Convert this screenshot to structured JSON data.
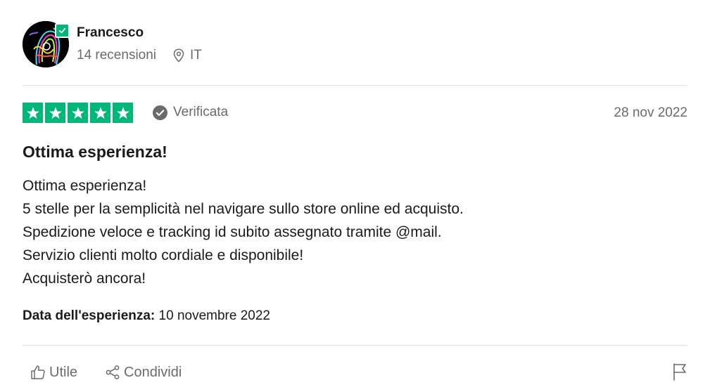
{
  "reviewer": {
    "name": "Francesco",
    "reviews_count": "14 recensioni",
    "country": "IT",
    "avatar_icon": "psychedelic-portrait-avatar"
  },
  "review": {
    "rating": 5,
    "rating_max": 5,
    "verified_label": "Verificata",
    "date": "28 nov 2022",
    "title": "Ottima esperienza!",
    "body_lines": [
      "Ottima esperienza!",
      "5 stelle per la semplicità nel navigare sullo store online ed acquisto.",
      "Spedizione veloce e tracking id subito assegnato tramite @mail.",
      "Servizio clienti molto cordiale e disponibile!",
      "Acquisterò ancora!"
    ],
    "experience_label": "Data dell'esperienza:",
    "experience_date": "10 novembre 2022"
  },
  "actions": {
    "useful_label": "Utile",
    "share_label": "Condividi",
    "flag_icon": "flag-icon"
  },
  "colors": {
    "star_green": "#00b67a",
    "muted_text": "#6b6b6b",
    "divider": "#dcdce6"
  }
}
